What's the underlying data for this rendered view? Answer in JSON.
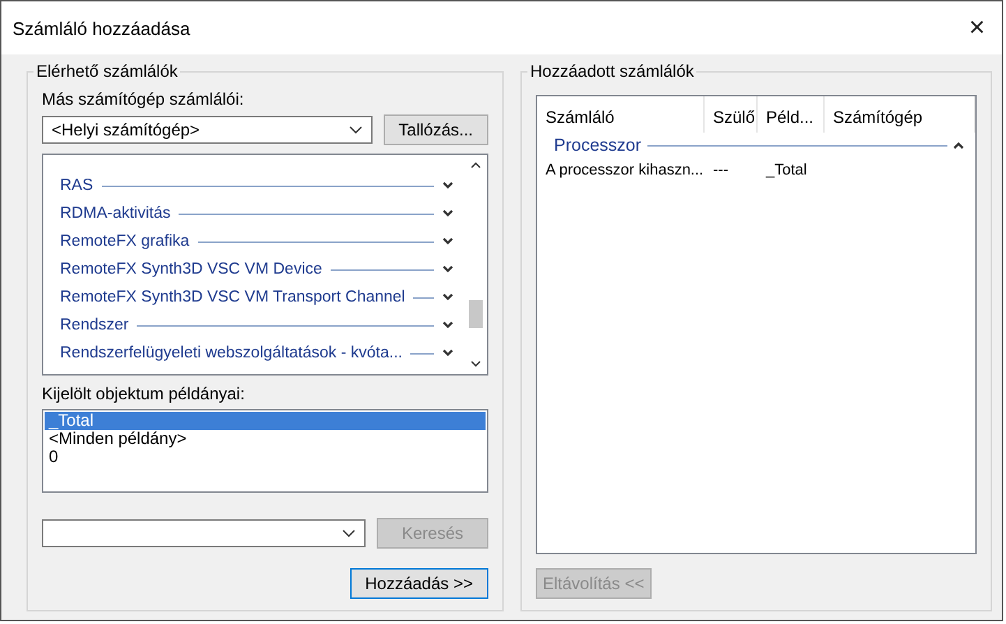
{
  "window": {
    "title": "Számláló hozzáadása",
    "close": "×"
  },
  "available": {
    "title": "Elérhető számlálók",
    "computer_label": "Más számítógép számlálói:",
    "computer": {
      "value": "<Helyi számítógép>"
    },
    "browse_button": "Tallózás...",
    "counters": [
      {
        "name": "RAS",
        "expanded": false
      },
      {
        "name": "RDMA-aktivitás",
        "expanded": false
      },
      {
        "name": "RemoteFX grafika",
        "expanded": false
      },
      {
        "name": "RemoteFX Synth3D VSC VM Device",
        "expanded": false
      },
      {
        "name": "RemoteFX Synth3D VSC VM Transport Channel",
        "expanded": false
      },
      {
        "name": "Rendszer",
        "expanded": false
      },
      {
        "name": "Rendszerfelügyeleti webszolgáltatások - kvóta...",
        "expanded": false
      }
    ],
    "instances_label": "Kijelölt objektum példányai:",
    "instances": [
      {
        "label": "_Total",
        "selected": true
      },
      {
        "label": "<Minden példány>",
        "selected": false
      },
      {
        "label": "0",
        "selected": false
      }
    ],
    "search": {
      "disabled": true,
      "button": "Keresés"
    },
    "add_button": "Hozzáadás >>"
  },
  "added": {
    "title": "Hozzáadott számlálók",
    "columns": [
      "Számláló",
      "Szülő",
      "Péld...",
      "Számítógép"
    ],
    "groups": [
      {
        "name": "Processzor",
        "expanded": true,
        "rows": [
          [
            "A processzor kihaszn...",
            "---",
            "_Total",
            ""
          ]
        ]
      }
    ],
    "remove_button": {
      "label": "Eltávolítás <<",
      "disabled": true
    }
  }
}
